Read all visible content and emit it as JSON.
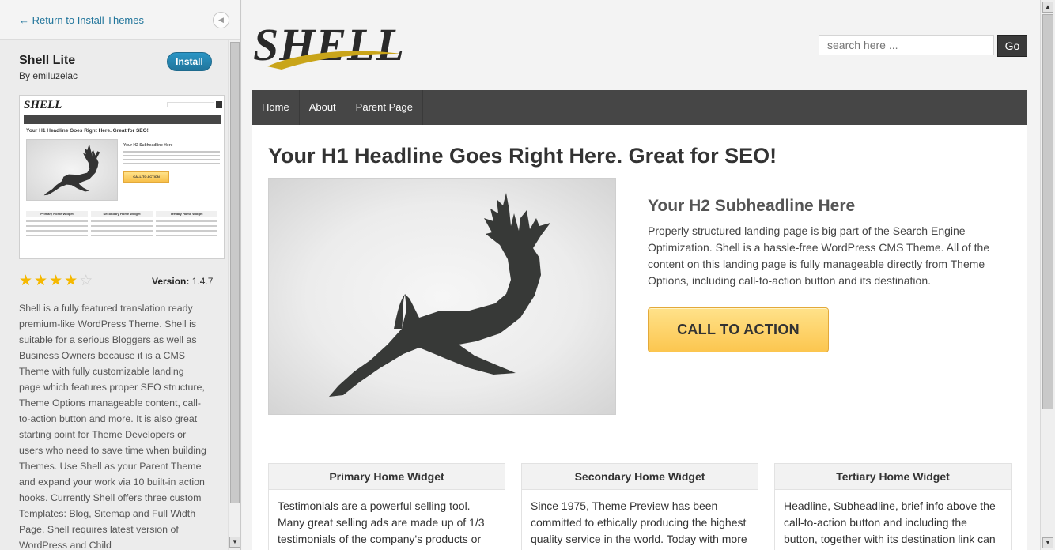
{
  "sidebar": {
    "return_link": "← Return to Install Themes",
    "theme_name": "Shell Lite",
    "author": "By emiluzelac",
    "install_label": "Install",
    "rating": {
      "value": 4,
      "max": 5
    },
    "version_label": "Version:",
    "version_value": "1.4.7",
    "description": "Shell is a fully featured translation ready premium-like WordPress Theme. Shell is suitable for a serious Bloggers as well as Business Owners because it is a CMS Theme with fully customizable landing page which features proper SEO structure, Theme Options manageable content, call-to-action button and more. It is also great starting point for Theme Developers or users who need to save time when building Themes. Use Shell as your Parent Theme and expand your work via 10 built-in action hooks. Currently Shell offers three custom Templates: Blog, Sitemap and Full Width Page. Shell requires latest version of WordPress and Child",
    "thumbnail": {
      "logo": "SHELL",
      "h1": "Your H1 Headline Goes Right Here. Great for SEO!",
      "h2": "Your H2 Subheadline Here",
      "cta": "CALL TO ACTION",
      "widgets": [
        "Primary Home Widget",
        "Secondary Home Widget",
        "Tertiary Home Widget"
      ]
    }
  },
  "preview": {
    "logo": "SHELL",
    "search_placeholder": "search here ...",
    "go_label": "Go",
    "nav": [
      "Home",
      "About",
      "Parent Page"
    ],
    "h1": "Your H1 Headline Goes Right Here. Great for SEO!",
    "h2": "Your H2 Subheadline Here",
    "intro": "Properly structured landing page is big part of the Search Engine Optimization. Shell is a hassle-free WordPress CMS Theme. All of the content on this landing page is fully manageable directly from Theme Options, including call-to-action button and its destination.",
    "cta_label": "CALL TO ACTION",
    "widgets": [
      {
        "title": "Primary Home Widget",
        "text": "Testimonials are a powerful selling tool. Many great selling ads are made up of 1/3 testimonials of the company's products or"
      },
      {
        "title": "Secondary Home Widget",
        "text": "Since 1975, Theme Preview has been committed to ethically producing the highest quality service in the world. Today with more"
      },
      {
        "title": "Tertiary Home Widget",
        "text": "Headline, Subheadline, brief info above the call-to-action button and including the button, together with its destination link can"
      }
    ]
  },
  "colors": {
    "nav_bg": "#464646",
    "link": "#21759b",
    "cta": "#fcc64f",
    "logo_swoosh": "#c9a51a"
  }
}
